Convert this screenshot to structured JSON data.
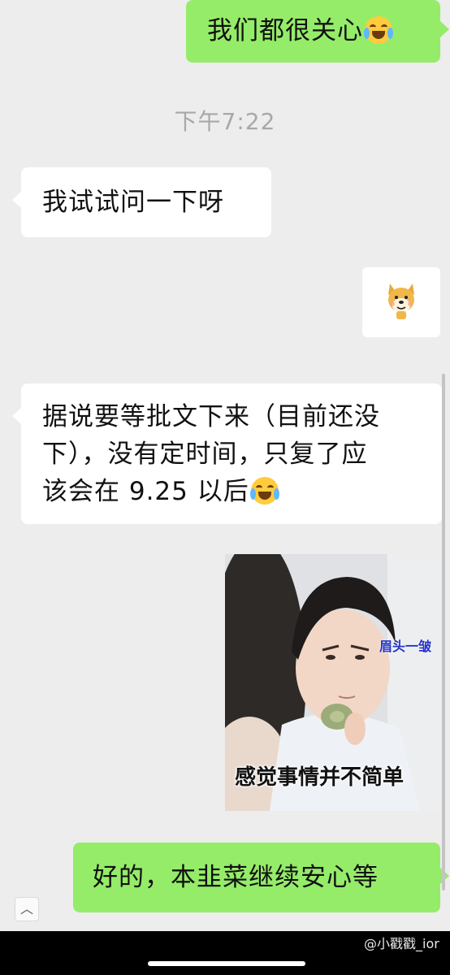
{
  "messages": {
    "m1": {
      "text": "我们都很关心",
      "emoji": "crying-laughing-face"
    },
    "time": "下午7:22",
    "m2": {
      "text": "我试试问一下呀"
    },
    "m3": {
      "sticker": "doge-sticker"
    },
    "m4": {
      "line1": "据说要等批文下来（目前还没",
      "line2": "下），没有定时间，只复了应",
      "line3": "该会在 9.25 以后",
      "emoji": "tears-of-joy-face"
    },
    "m5": {
      "caption": "感觉事情并不简单",
      "side_caption": "眉头一皱"
    },
    "m6": {
      "text": "好的，本韭菜继续安心等"
    }
  },
  "scroll_up_button": "︿",
  "watermark": "@小戳戳_ior",
  "colors": {
    "outgoing": "#95ec69",
    "incoming": "#ffffff",
    "background": "#ededed"
  }
}
